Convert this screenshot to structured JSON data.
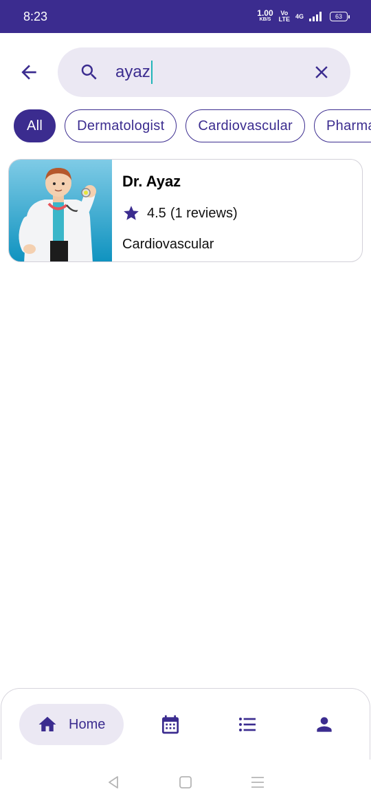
{
  "status_bar": {
    "time": "8:23",
    "net_speed_value": "1.00",
    "net_speed_unit": "KB/S",
    "volte_top": "Vo",
    "volte_bottom": "LTE",
    "network": "4G",
    "battery": "63"
  },
  "search": {
    "value": "ayaz",
    "back_icon": "arrow-left-icon",
    "search_icon": "search-icon",
    "clear_icon": "close-icon"
  },
  "filters": {
    "chips": [
      "All",
      "Dermatologist",
      "Cardiovascular",
      "Pharmacist"
    ],
    "selected": "All"
  },
  "results": [
    {
      "name": "Dr. Ayaz",
      "rating": "4.5",
      "reviews": "(1 reviews)",
      "specialty": "Cardiovascular",
      "image_icon": "doctor-avatar"
    }
  ],
  "bottom_nav": {
    "home_label": "Home",
    "items": [
      "home-icon",
      "calendar-icon",
      "list-icon",
      "person-icon"
    ]
  },
  "colors": {
    "primary": "#3b2c8f",
    "chip_bg": "#ebe8f3",
    "accent": "#1fb5b8"
  }
}
